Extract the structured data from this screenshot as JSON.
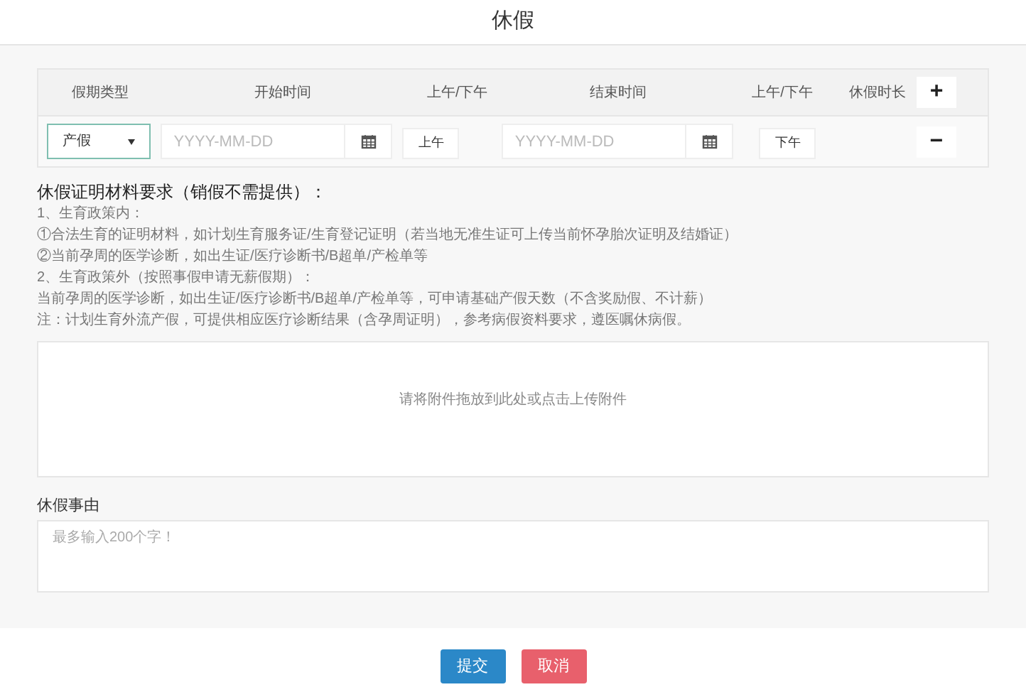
{
  "window": {
    "title": "休假"
  },
  "table": {
    "columns": [
      "假期类型",
      "开始时间",
      "上午/下午",
      "结束时间",
      "上午/下午",
      "休假时长"
    ],
    "add_button": "+",
    "rows": [
      {
        "type": "产假",
        "start_placeholder": "YYYY-MM-DD",
        "start_period": "上午",
        "end_placeholder": "YYYY-MM-DD",
        "end_period": "下午",
        "remove_button": "−"
      }
    ]
  },
  "requirements": {
    "heading": "休假证明材料要求（销假不需提供）：",
    "lines": [
      "1、生育政策内：",
      "①合法生育的证明材料，如计划生育服务证/生育登记证明（若当地无准生证可上传当前怀孕胎次证明及结婚证）",
      "②当前孕周的医学诊断，如出生证/医疗诊断书/B超单/产检单等",
      "2、生育政策外（按照事假申请无薪假期）：",
      "当前孕周的医学诊断，如出生证/医疗诊断书/B超单/产检单等，可申请基础产假天数（不含奖励假、不计薪）",
      "注：计划生育外流产假，可提供相应医疗诊断结果（含孕周证明），参考病假资料要求，遵医嘱休病假。"
    ]
  },
  "upload": {
    "hint": "请将附件拖放到此处或点击上传附件"
  },
  "reason": {
    "label": "休假事由",
    "placeholder": "最多输入200个字！"
  },
  "buttons": [
    {
      "kind": "submit",
      "label": "提交"
    },
    {
      "kind": "cancel",
      "label": "取消"
    }
  ]
}
